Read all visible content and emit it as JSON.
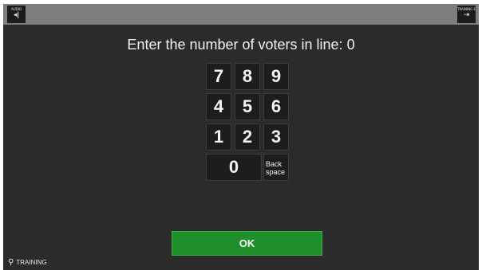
{
  "topbar": {
    "left_button": {
      "caption": "AUDIO",
      "icon": "speaker-icon",
      "glyph": "◂ǀ"
    },
    "right_button": {
      "caption": "TRAINING EXIT",
      "icon": "exit-icon",
      "glyph": "⇥"
    }
  },
  "prompt": "Enter the number of voters in line: 0",
  "keypad": {
    "k7": "7",
    "k8": "8",
    "k9": "9",
    "k4": "4",
    "k5": "5",
    "k6": "6",
    "k1": "1",
    "k2": "2",
    "k3": "3",
    "k0": "0",
    "backspace_line1": "Back",
    "backspace_line2": "space"
  },
  "ok_label": "OK",
  "status": {
    "icon": "lightbulb-icon",
    "label": "TRAINING"
  },
  "colors": {
    "background": "#2b2b2b",
    "topbar": "#7d7d7d",
    "ok_green": "#1e8f2a"
  }
}
